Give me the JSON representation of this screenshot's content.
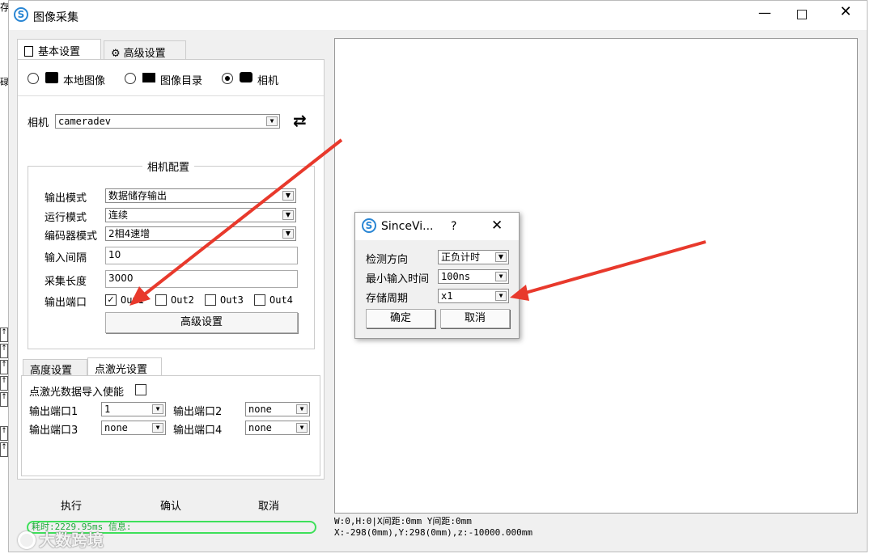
{
  "window": {
    "title": "图像采集"
  },
  "edge": {
    "top_char": "存",
    "left_char": "碌"
  },
  "top_tabs": [
    {
      "label": "基本设置"
    },
    {
      "label": "高级设置"
    }
  ],
  "source": {
    "options": [
      "本地图像",
      "图像目录",
      "相机"
    ],
    "selected": "相机"
  },
  "camera": {
    "label": "相机",
    "value": "cameradev"
  },
  "config": {
    "title": "相机配置",
    "rows": [
      {
        "label": "输出模式",
        "value": "数据储存输出"
      },
      {
        "label": "运行模式",
        "value": "连续"
      },
      {
        "label": "编码器模式",
        "value": "2相4速增"
      },
      {
        "label": "输入间隔",
        "value": "10"
      },
      {
        "label": "采集长度",
        "value": "3000"
      }
    ],
    "ports_label": "输出端口",
    "ports": [
      {
        "label": "Out1",
        "checked": true
      },
      {
        "label": "Out2",
        "checked": false
      },
      {
        "label": "Out3",
        "checked": false
      },
      {
        "label": "Out4",
        "checked": false
      }
    ],
    "advanced_button": "高级设置"
  },
  "sub_tabs": [
    {
      "label": "高度设置"
    },
    {
      "label": "点激光设置"
    }
  ],
  "laser": {
    "enable_label": "点激光数据导入使能",
    "ports": [
      {
        "label": "输出端口1",
        "value": "1"
      },
      {
        "label": "输出端口2",
        "value": "none"
      },
      {
        "label": "输出端口3",
        "value": "none"
      },
      {
        "label": "输出端口4",
        "value": "none"
      }
    ]
  },
  "actions": {
    "run": "执行",
    "confirm": "确认",
    "cancel": "取消"
  },
  "status": {
    "text": "耗时:2229.95ms 信息:"
  },
  "coords": {
    "line1": "W:0,H:0|X间距:0mm Y间距:0mm",
    "line2": "X:-298(0mm),Y:298(0mm),z:-10000.000mm"
  },
  "dialog": {
    "title": "SinceVi...",
    "help": "?",
    "rows": [
      {
        "label": "检测方向",
        "value": "正负计时"
      },
      {
        "label": "最小输入时间",
        "value": "100ns"
      },
      {
        "label": "存储周期",
        "value": "x1"
      }
    ],
    "ok": "确定",
    "cancel": "取消"
  },
  "watermark": "大数跨境",
  "arrow_color": "#e8392c",
  "accent": "#2a86d4"
}
